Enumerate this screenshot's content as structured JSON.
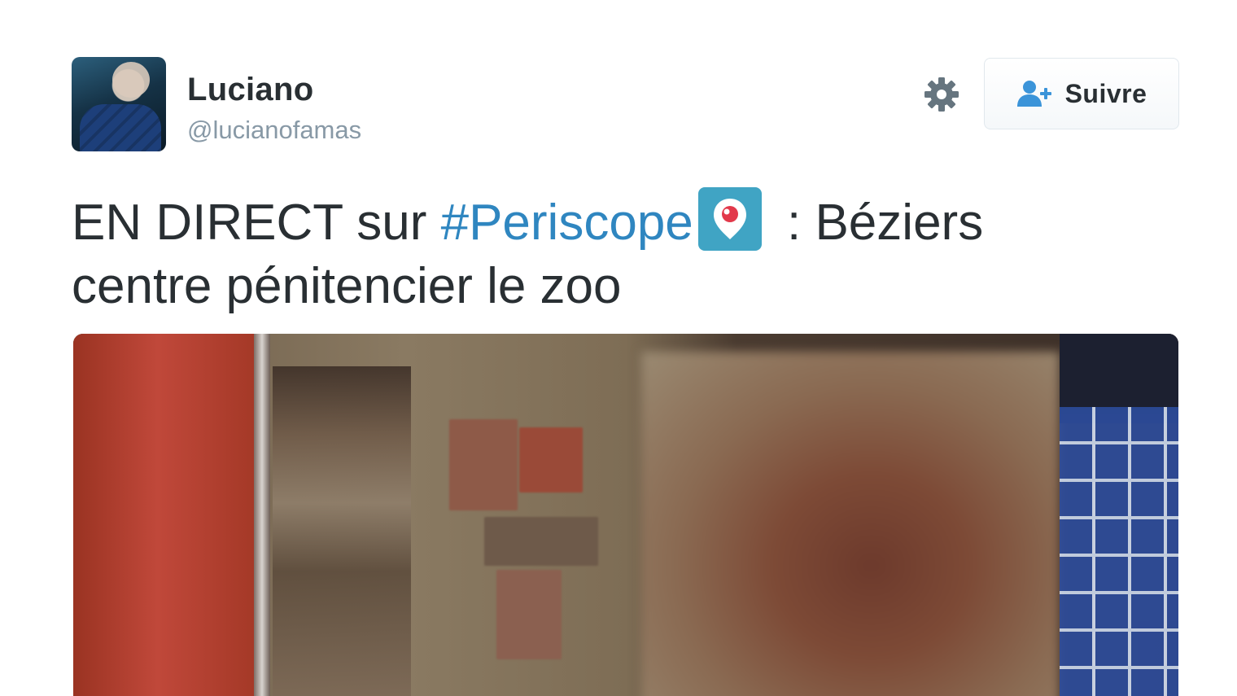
{
  "user": {
    "name": "Luciano",
    "handle": "@lucianofamas"
  },
  "actions": {
    "settings_icon": "gear-icon",
    "follow_label": "Suivre",
    "follow_icon": "add-user-icon"
  },
  "tweet": {
    "text_before": "EN DIRECT sur ",
    "hashtag": "#Periscope",
    "text_after": " : Béziers centre pénitencier le zoo"
  },
  "colors": {
    "hashtag": "#2f86c0",
    "periscope_badge": "#40a4c4",
    "follow_icon": "#3b94d9"
  }
}
